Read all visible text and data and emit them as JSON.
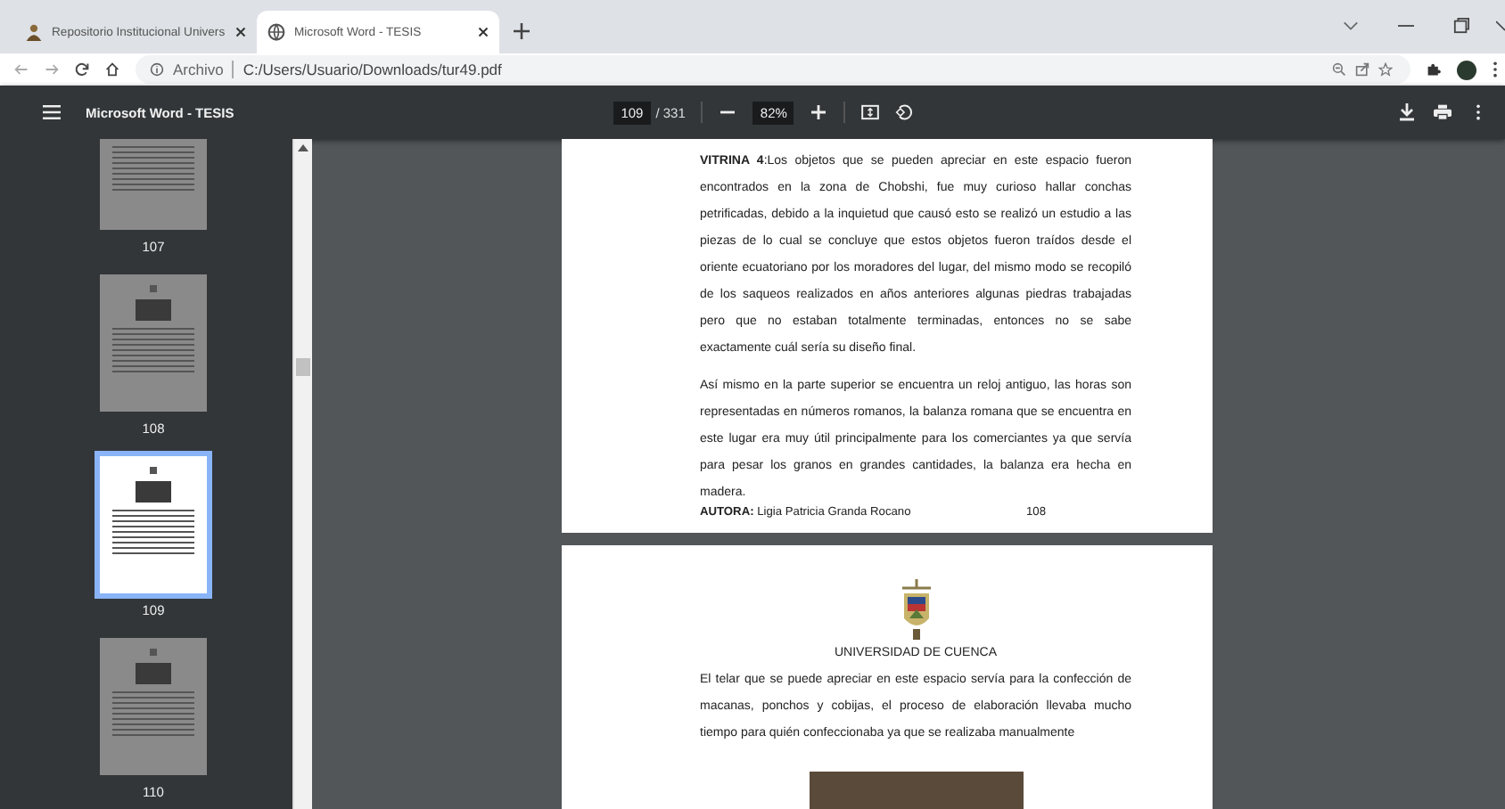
{
  "browser_tabs": [
    {
      "title": "Repositorio Institucional Univers",
      "selected": false
    },
    {
      "title": "Microsoft Word - TESIS",
      "selected": true
    }
  ],
  "address_bar": {
    "security_label": "Archivo",
    "url": "C:/Users/Usuario/Downloads/tur49.pdf"
  },
  "pdf_toolbar": {
    "title": "Microsoft Word - TESIS",
    "page": "109",
    "page_total": "/ 331",
    "zoom": "82%"
  },
  "thumbnails": [
    {
      "label": "107",
      "selected": false
    },
    {
      "label": "108",
      "selected": false
    },
    {
      "label": "109",
      "selected": true
    },
    {
      "label": "110",
      "selected": false
    }
  ],
  "pages": [
    {
      "paragraphs": [
        "**VITRINA 4**:Los objetos que se pueden apreciar en este espacio fueron encontrados en la zona de Chobshi, fue muy curioso hallar conchas petrificadas, debido a la inquietud que causó esto se realizó un estudio a las piezas de lo cual se concluye que estos objetos fueron traídos desde el oriente ecuatoriano por los moradores del lugar, del mismo modo se recopiló de los saqueos realizados en años anteriores algunas piedras trabajadas pero que no estaban totalmente terminadas, entonces no se sabe exactamente cuál sería su diseño final.",
        "Así mismo en la parte superior se encuentra un reloj antiguo, las horas son representadas en números romanos, la balanza romana que se encuentra en este lugar era muy útil principalmente para los comerciantes ya que servía para pesar los granos en grandes cantidades, la balanza era hecha en madera."
      ],
      "author": "**AUTORA:** Ligia Patricia Granda Rocano",
      "page_number": "108"
    },
    {
      "header": "UNIVERSIDAD DE CUENCA",
      "paragraphs": [
        "El telar que se puede apreciar en este espacio servía para la confección de macanas, ponchos y cobijas, el proceso de elaboración llevaba mucho tiempo para quién confeccionaba ya que se realizaba manualmente"
      ],
      "photo": true
    }
  ]
}
